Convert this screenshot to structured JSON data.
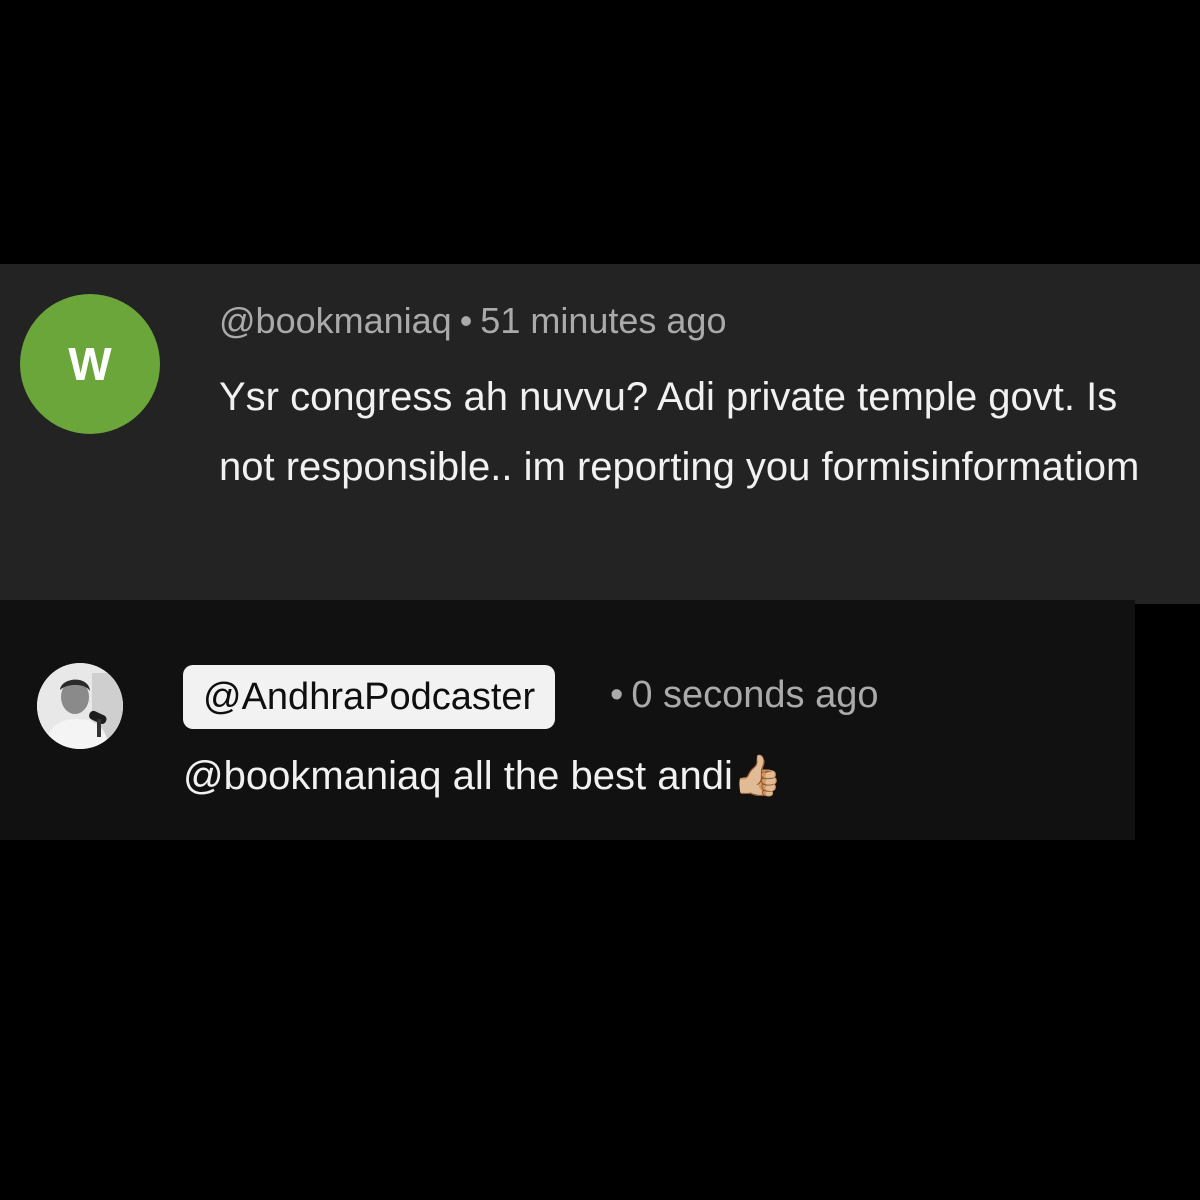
{
  "comments": [
    {
      "avatar_letter": "W",
      "avatar_color": "#6aa63a",
      "author": "@bookmaniaq",
      "separator": "•",
      "time": "51 minutes ago",
      "text": "Ysr congress ah nuvvu? Adi private temple govt. Is not responsible.. im reporting you formisinformatiom"
    },
    {
      "avatar_icon": "user-photo",
      "author": "@AndhraPodcaster",
      "separator": "•",
      "time": "0 seconds ago",
      "text": "@bookmaniaq all the best andi👍🏼"
    }
  ]
}
